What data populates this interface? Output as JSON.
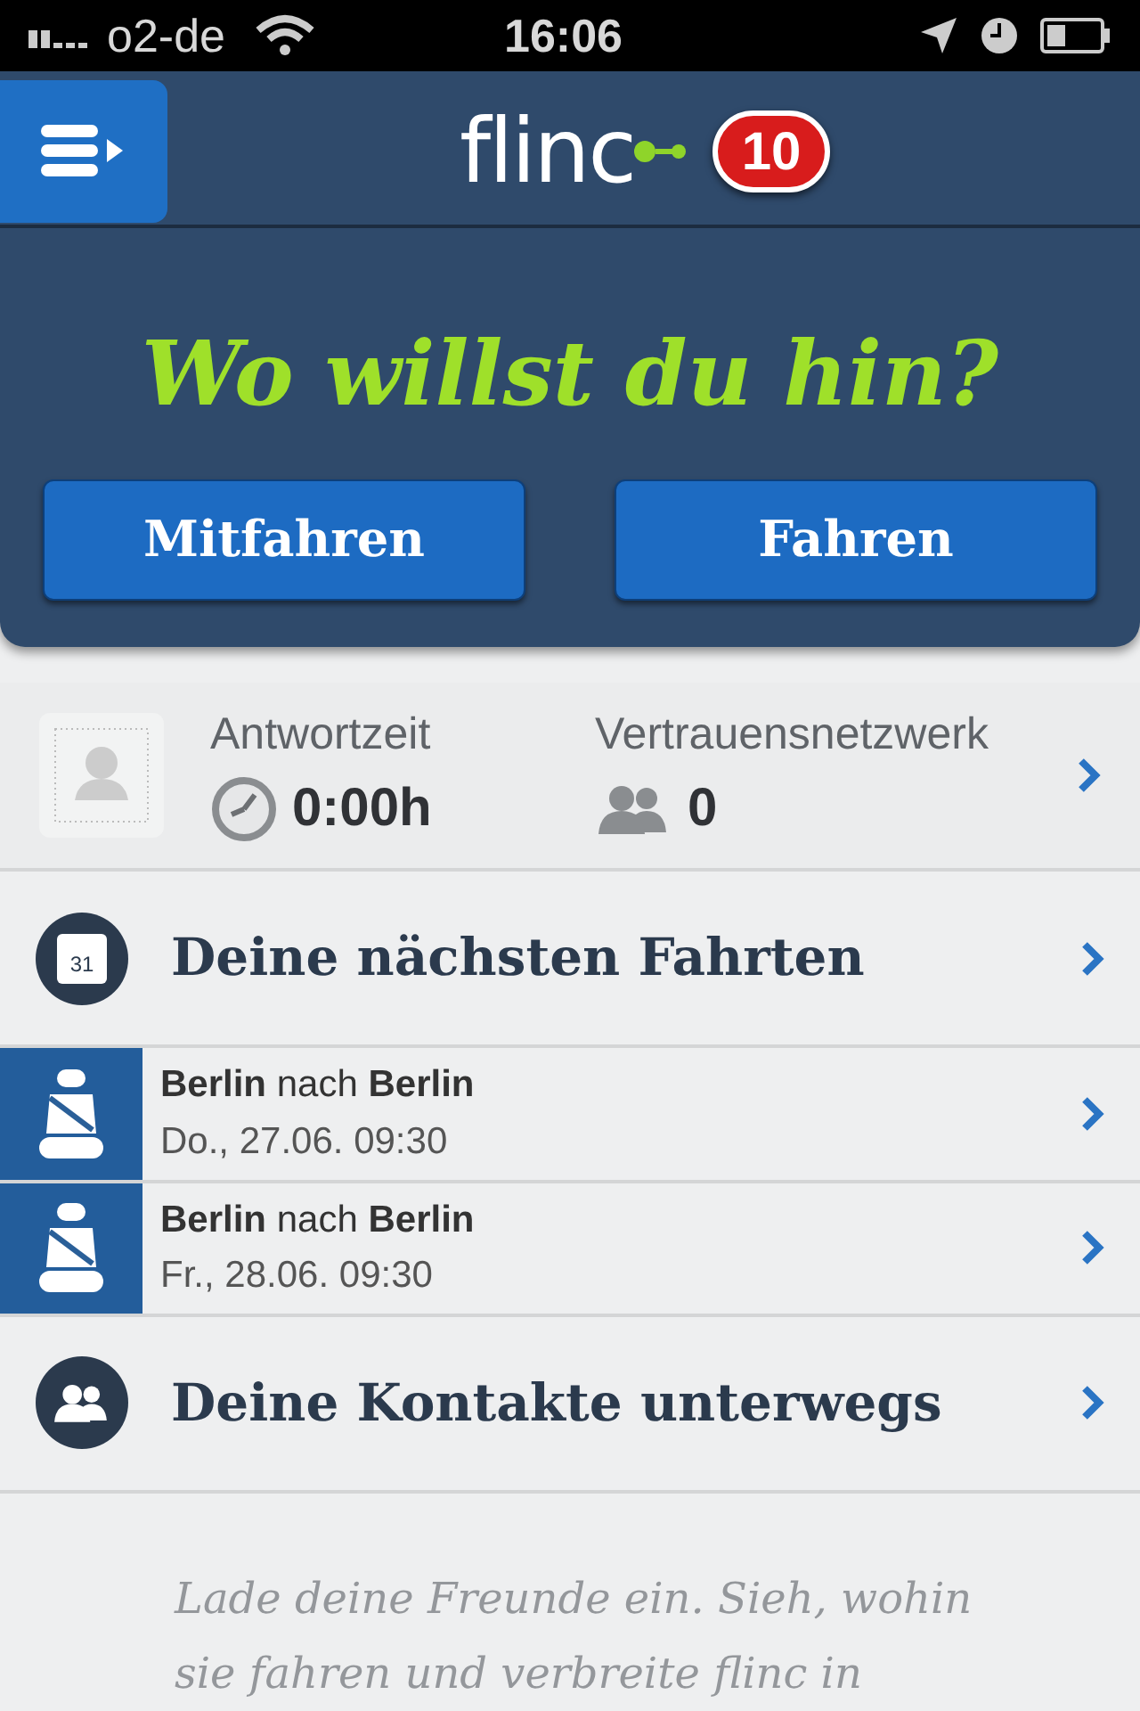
{
  "status_bar": {
    "carrier": "o2-de",
    "time": "16:06"
  },
  "navbar": {
    "logo": "flinc",
    "badge": "10"
  },
  "hero": {
    "title": "Wo willst du hin?",
    "buttons": [
      "Mitfahren",
      "Fahren"
    ]
  },
  "stats": [
    {
      "label": "Antwortzeit",
      "value": "0:00h",
      "kind": "clock"
    },
    {
      "label": "Vertrauensnetzwerk",
      "value": "0",
      "kind": "people"
    }
  ],
  "sections": [
    {
      "kind": "calendar",
      "title": "Deine nächsten Fahrten",
      "icon_text": "31"
    },
    {
      "kind": "ride",
      "title": "**Berlin** nach **Berlin**",
      "date": "Do., 27.06. 09:30"
    },
    {
      "kind": "ride",
      "title": "**Berlin** nach **Berlin**",
      "date": "Fr., 28.06. 09:30"
    },
    {
      "kind": "contacts",
      "title": "Deine Kontakte unterwegs"
    }
  ],
  "footer_text": "Lade deine Freunde ein. Sieh, wohin sie fahren und verbreite flinc in"
}
